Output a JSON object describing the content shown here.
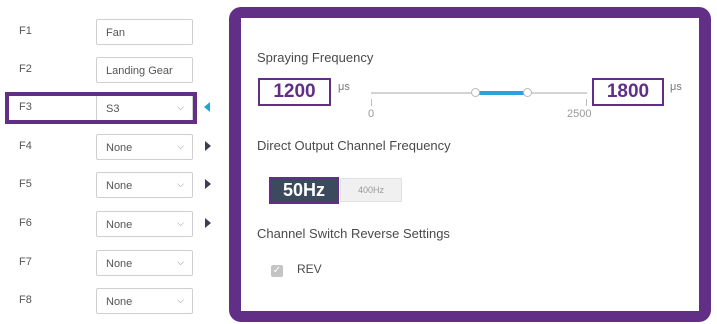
{
  "channels": [
    {
      "id": "F1",
      "value": "Fan",
      "dropdown": false,
      "arrow": "none"
    },
    {
      "id": "F2",
      "value": "Landing Gear",
      "dropdown": false,
      "arrow": "none"
    },
    {
      "id": "F3",
      "value": "S3",
      "dropdown": true,
      "arrow": "left",
      "selected": true
    },
    {
      "id": "F4",
      "value": "None",
      "dropdown": true,
      "arrow": "right"
    },
    {
      "id": "F5",
      "value": "None",
      "dropdown": true,
      "arrow": "right"
    },
    {
      "id": "F6",
      "value": "None",
      "dropdown": true,
      "arrow": "right"
    },
    {
      "id": "F7",
      "value": "None",
      "dropdown": true,
      "arrow": "none"
    },
    {
      "id": "F8",
      "value": "None",
      "dropdown": true,
      "arrow": "none"
    }
  ],
  "panel": {
    "spraying_title": "Spraying Frequency",
    "min_value": "1200",
    "max_value": "1800",
    "unit": "μs",
    "slider_min_label": "0",
    "slider_max_label": "2500",
    "slider_range": [
      0,
      2500
    ],
    "slider_low": 1200,
    "slider_high": 1800,
    "direct_title": "Direct Output Channel Frequency",
    "freq_selected": "50Hz",
    "freq_other": "400Hz",
    "reverse_title": "Channel Switch Reverse Settings",
    "rev_label": "REV",
    "rev_checked": true
  },
  "colors": {
    "accent": "#612f86",
    "slider_fill": "#27a3e0",
    "selected_button": "#3b4a5c"
  }
}
